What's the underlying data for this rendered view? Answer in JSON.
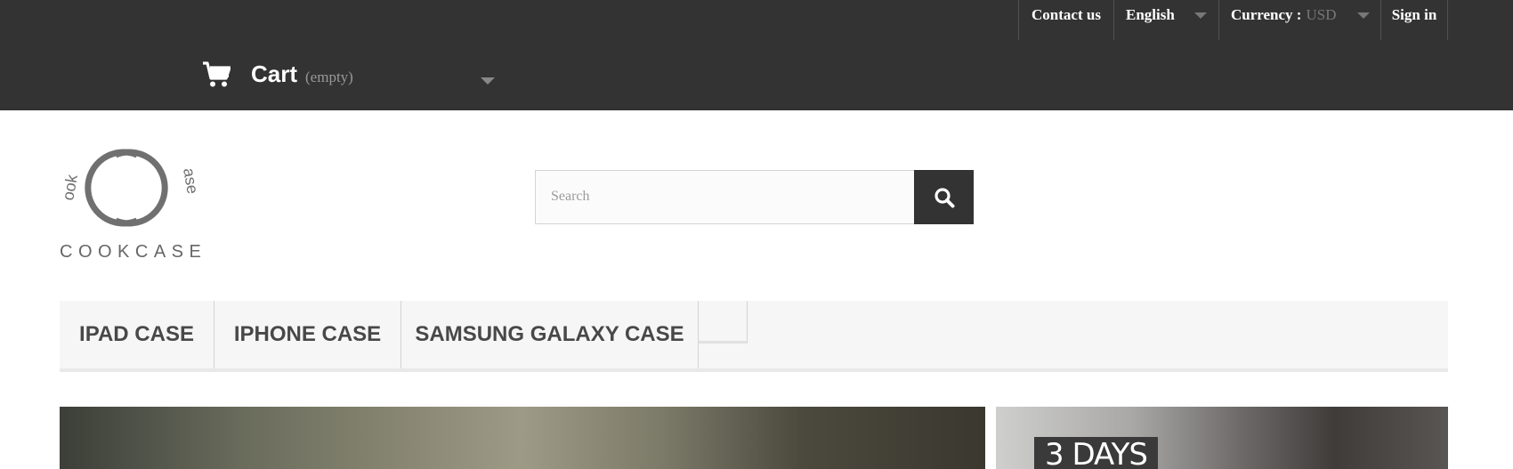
{
  "header": {
    "top_links": {
      "contact": "Contact us",
      "language": "English",
      "currency_label": "Currency :",
      "currency_value": "USD",
      "sign_in": "Sign in"
    },
    "cart": {
      "label": "Cart",
      "status": "(empty)",
      "icon": "shopping-cart-icon"
    }
  },
  "logo": {
    "text": "COOKCASE",
    "ring_left_text": "ook",
    "ring_right_text": "ase"
  },
  "search": {
    "placeholder": "Search",
    "icon": "search-icon"
  },
  "menu": {
    "items": [
      {
        "label": "IPAD CASE"
      },
      {
        "label": "IPHONE CASE"
      },
      {
        "label": "SAMSUNG GALAXY CASE"
      }
    ]
  },
  "banners": {
    "right_promo": "3 DAYS"
  },
  "colors": {
    "header_bg": "#333333",
    "menu_bg": "#f6f6f6",
    "search_button_bg": "#333333"
  }
}
